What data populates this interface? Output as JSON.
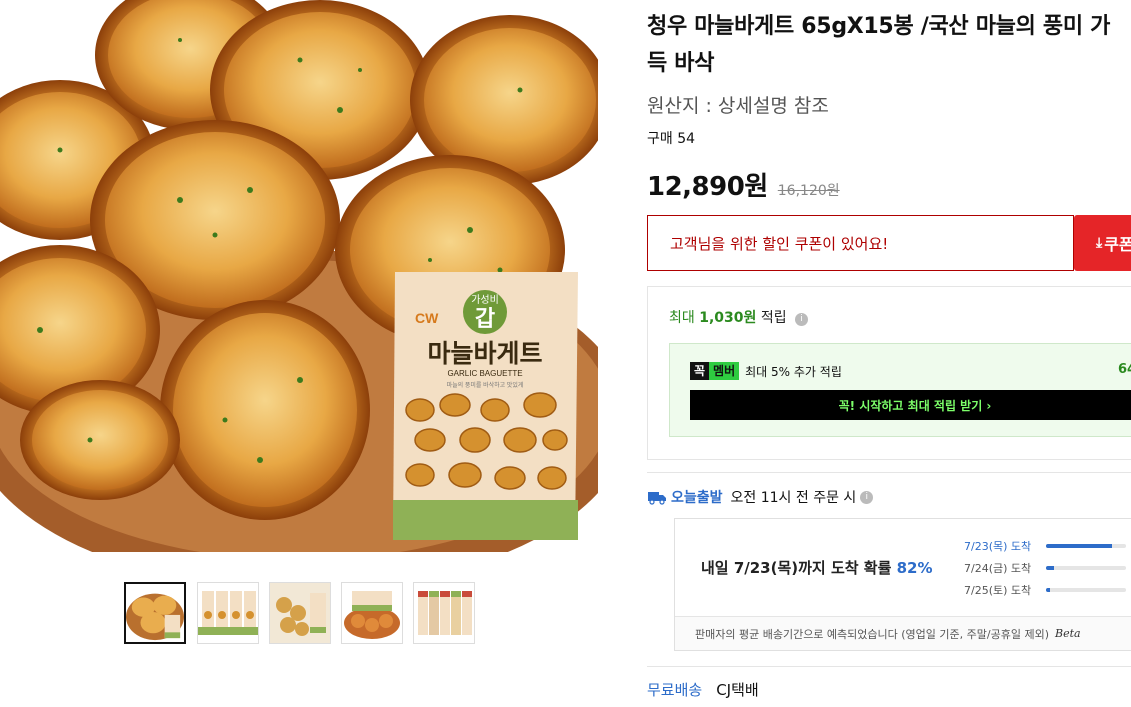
{
  "product": {
    "title": "청우 마늘바게트 65gX15봉 /국산 마늘의 풍미 가득 바삭",
    "origin": "원산지 : 상세설명 참조",
    "purchase_count": "구매 54",
    "price": "12,890원",
    "original_price": "16,120원"
  },
  "package": {
    "badge_top": "가성비",
    "badge_main": "갑",
    "brand": "CW",
    "name": "마늘바게트",
    "name_en": "GARLIC BAGUETTE",
    "tagline": "마늘의 풍미를 바삭하고 맛있게"
  },
  "coupon": {
    "message": "고객님을 위한 할인 쿠폰이 있어요!",
    "button_label": "쿠폰"
  },
  "reward": {
    "prefix": "최대",
    "amount": "1,030원",
    "suffix": "적립",
    "member_logo_a": "꼭",
    "member_logo_b": "멤버",
    "member_text": "최대 5% 추가 적립",
    "member_value": "64",
    "member_cta": "꼭! 시작하고 최대 적립 받기 ›"
  },
  "delivery": {
    "today_label": "오늘출발",
    "today_text": "오전 11시 전 주문 시",
    "prob_main": "내일 7/23(목)까지 도착 확률",
    "prob_pct": "82%",
    "dates": [
      {
        "label": "7/23(목) 도착",
        "fill": 0.82
      },
      {
        "label": "7/24(금) 도착",
        "fill": 0.1
      },
      {
        "label": "7/25(토) 도착",
        "fill": 0.05
      }
    ],
    "footnote": "판매자의 평균 배송기간으로 예측되었습니다 (영업일 기준, 주말/공휴일 제외)",
    "beta": "Beta",
    "free_shipping": "무료배송",
    "carrier": "CJ택배"
  },
  "colors": {
    "coupon_red": "#e52528",
    "reward_green": "#2b8a1f",
    "link_blue": "#2d6cc9"
  }
}
